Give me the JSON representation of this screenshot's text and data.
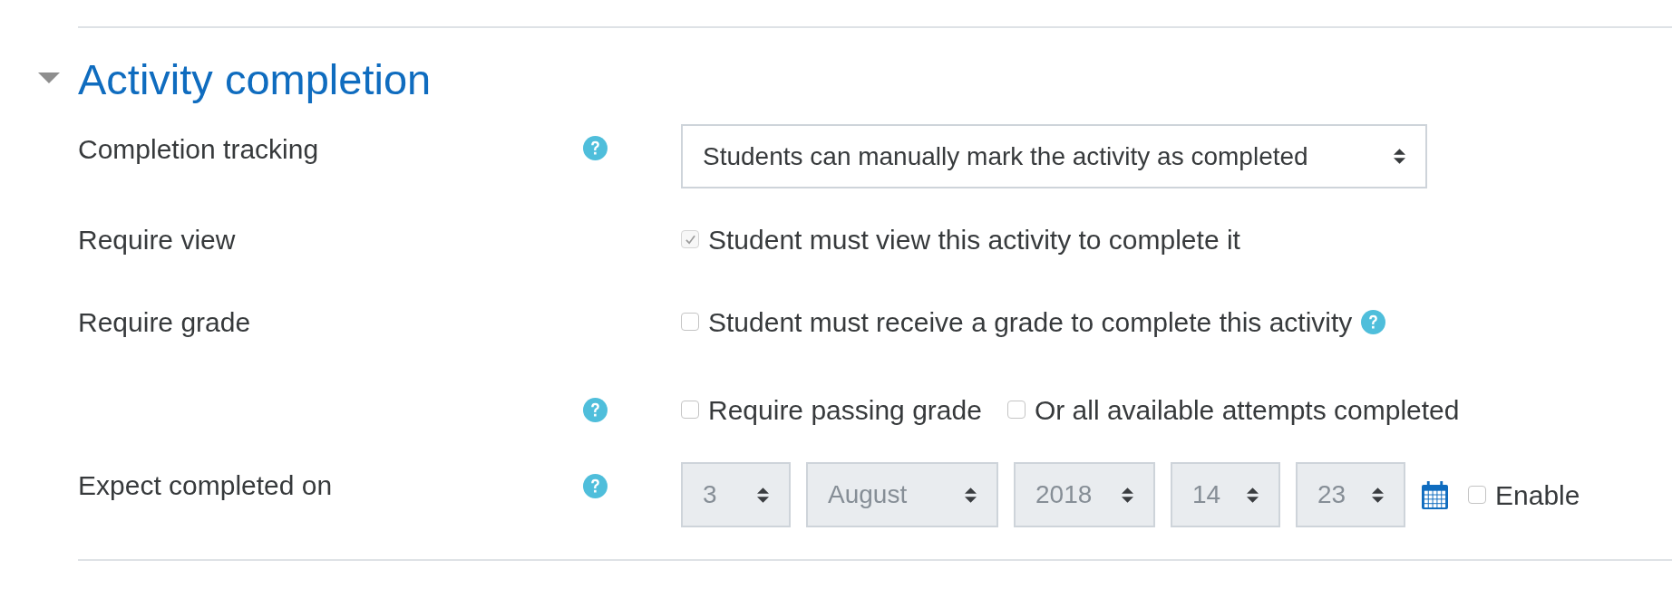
{
  "section": {
    "title": "Activity completion",
    "expanded": true
  },
  "fields": [
    {
      "kind": "select",
      "label": "Completion tracking",
      "help": true,
      "select": {
        "value": "Students can manually mark the activity as completed",
        "disabled": false
      }
    },
    {
      "kind": "checkboxes",
      "label": "Require view",
      "options": [
        {
          "label": "Student must view this activity to complete it",
          "checked": true,
          "disabled": true
        }
      ]
    },
    {
      "kind": "checkboxes",
      "label": "Require grade",
      "options": [
        {
          "label": "Student must receive a grade to complete this activity",
          "checked": false,
          "disabled": false,
          "help": true
        }
      ]
    },
    {
      "kind": "checkboxes",
      "help": true,
      "options": [
        {
          "label": "Require passing grade",
          "checked": false,
          "disabled": false
        },
        {
          "label": "Or all available attempts completed",
          "checked": false,
          "disabled": false
        }
      ]
    },
    {
      "kind": "date",
      "label": "Expect completed on",
      "help": true,
      "selects": [
        {
          "value": "3",
          "disabled": true
        },
        {
          "value": "August",
          "disabled": true
        },
        {
          "value": "2018",
          "disabled": true
        },
        {
          "value": "14",
          "disabled": true
        },
        {
          "value": "23",
          "disabled": true
        }
      ],
      "enable": {
        "label": "Enable",
        "checked": false
      }
    }
  ]
}
